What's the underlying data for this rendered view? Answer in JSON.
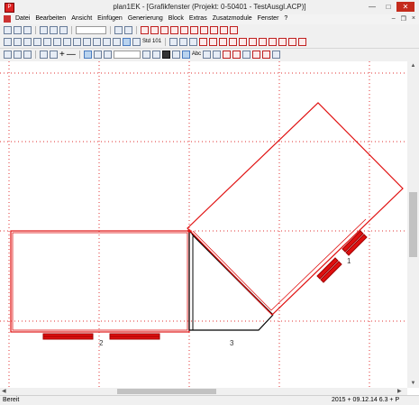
{
  "window": {
    "title": "plan1EK - [Grafikfenster (Projekt: 0-50401 - TestAusgl.ACP)]",
    "app_icon": "plan1ek-app-icon"
  },
  "menu": {
    "items": [
      "Datei",
      "Bearbeiten",
      "Ansicht",
      "Einfügen",
      "Generierung",
      "Block",
      "Extras",
      "Zusatzmodule",
      "Fenster",
      "?"
    ]
  },
  "toolbar": {
    "buttons_row2": [
      "Std",
      "101"
    ],
    "text_row3": [
      "Abc"
    ]
  },
  "drawing": {
    "labels": [
      "1",
      "2",
      "3"
    ],
    "grid_color": "#e03030",
    "outline_color": "#e01010",
    "line_color": "#000000"
  },
  "statusbar": {
    "left": "Bereit",
    "right": "2015 + 09.12.14   6.3 + P"
  }
}
